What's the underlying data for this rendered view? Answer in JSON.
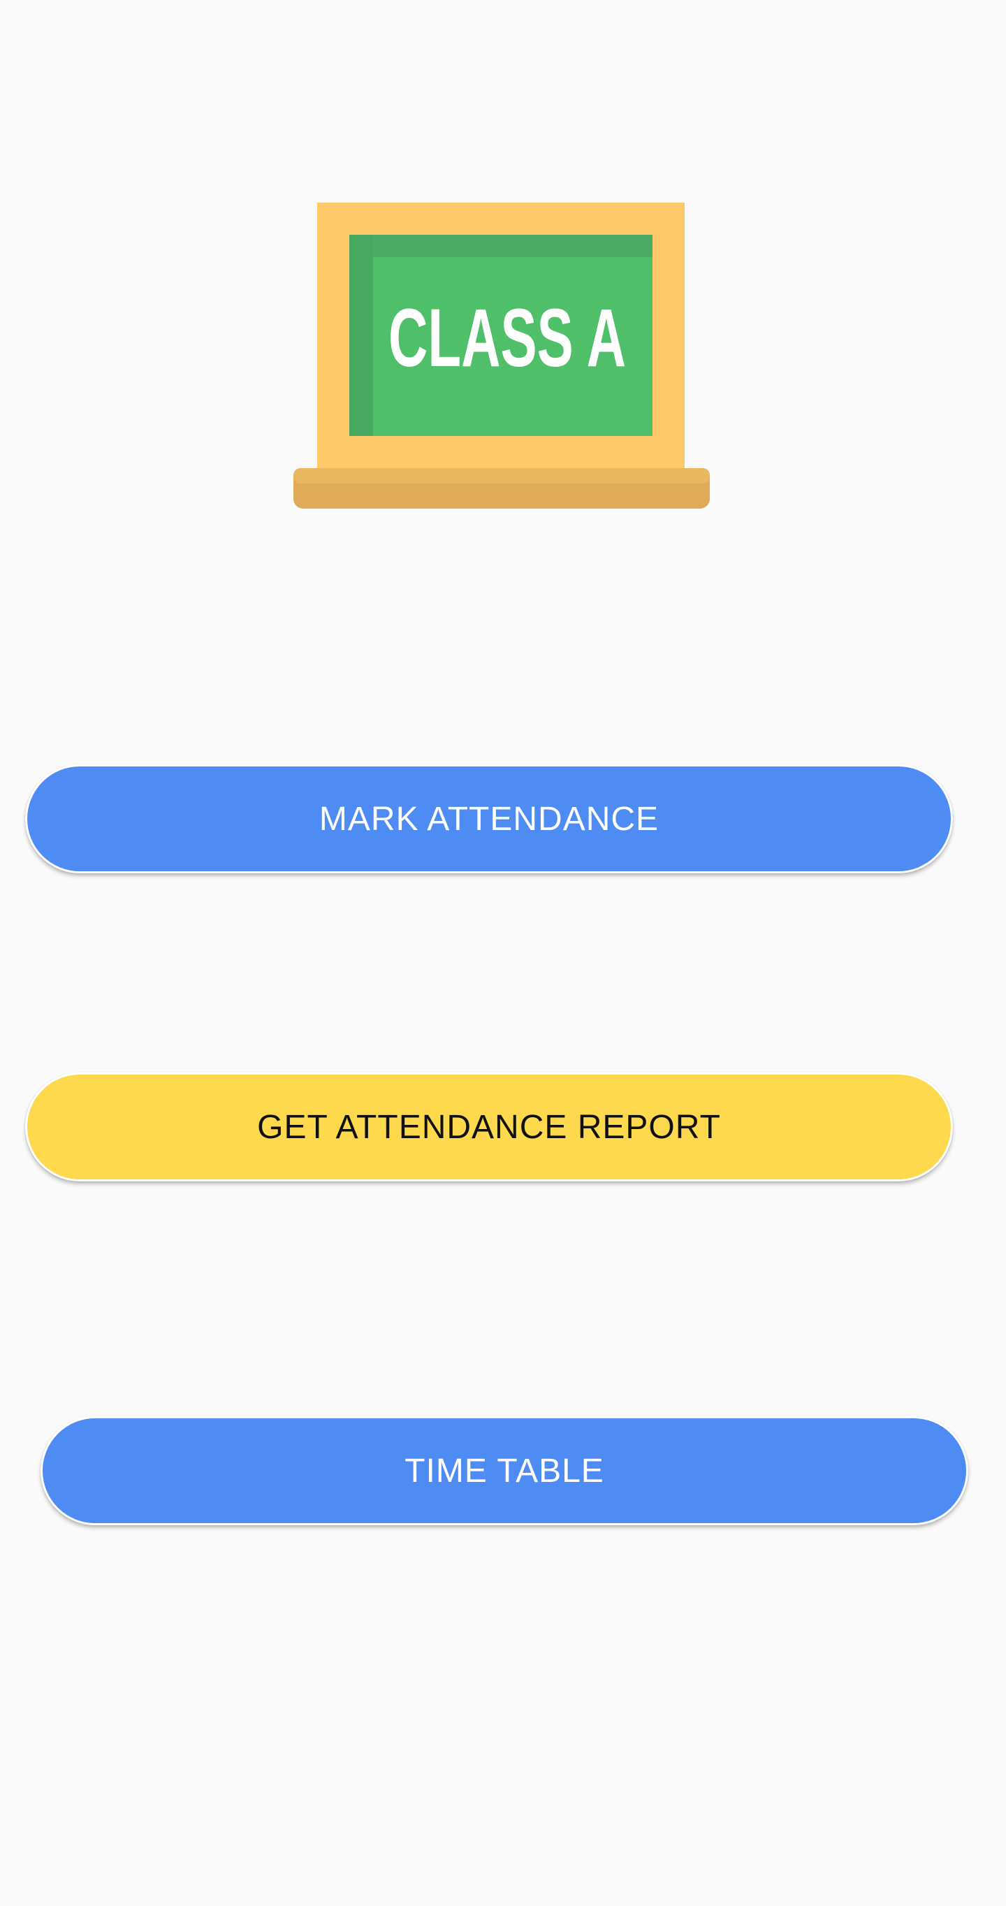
{
  "logo": {
    "icon": "chalkboard-icon",
    "text": "CLASS A",
    "colors": {
      "frame": "#ffc96a",
      "board": "#50bf6a",
      "board_shade": "#48a963",
      "ledge": "#e0ab58",
      "chalk": "#ffffff"
    }
  },
  "buttons": {
    "mark_attendance": "MARK ATTENDANCE",
    "get_report": "GET ATTENDANCE REPORT",
    "time_table": "TIME TABLE"
  },
  "colors": {
    "background": "#fafafa",
    "primary_button": "#4e8cf4",
    "accent_button": "#fed94d",
    "primary_text": "#ffffff",
    "accent_text": "#111111"
  }
}
